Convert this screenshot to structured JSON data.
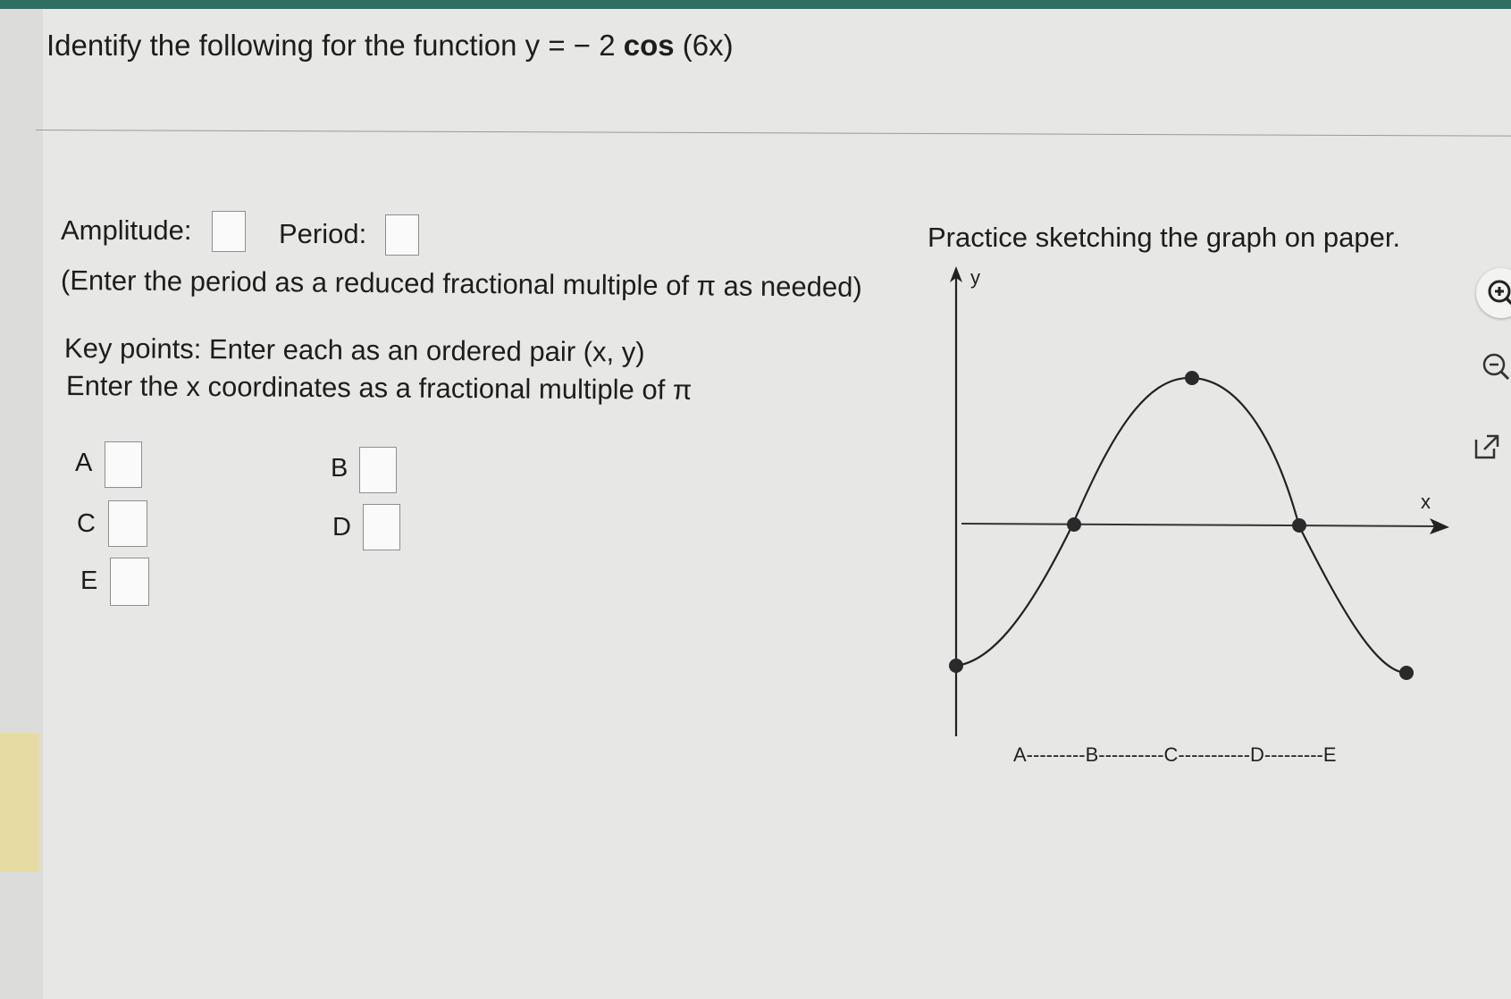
{
  "question": {
    "prefix": "Identify the following for the function ",
    "function_lhs": "y =  − 2 ",
    "function_cos": "cos",
    "function_arg": " (6x)"
  },
  "fields": {
    "amplitude_label": "Amplitude:",
    "period_label": "Period:",
    "period_hint": "(Enter the period as a reduced fractional multiple of π as needed)",
    "amplitude_value": "",
    "period_value": ""
  },
  "key_points": {
    "instruction_line1": "Key points: Enter each as an ordered pair (x, y)",
    "instruction_line2": "Enter the x coordinates as a fractional multiple of π",
    "labels": [
      "A",
      "B",
      "C",
      "D",
      "E"
    ]
  },
  "graph": {
    "heading": "Practice sketching the graph on paper.",
    "y_axis_label": "y",
    "x_axis_label": "x",
    "bottom_labels": "A---------B----------C-----------D---------E"
  },
  "toolbar": {
    "icons": [
      "zoom-in-icon",
      "zoom-out-icon",
      "external-link-icon"
    ]
  }
}
